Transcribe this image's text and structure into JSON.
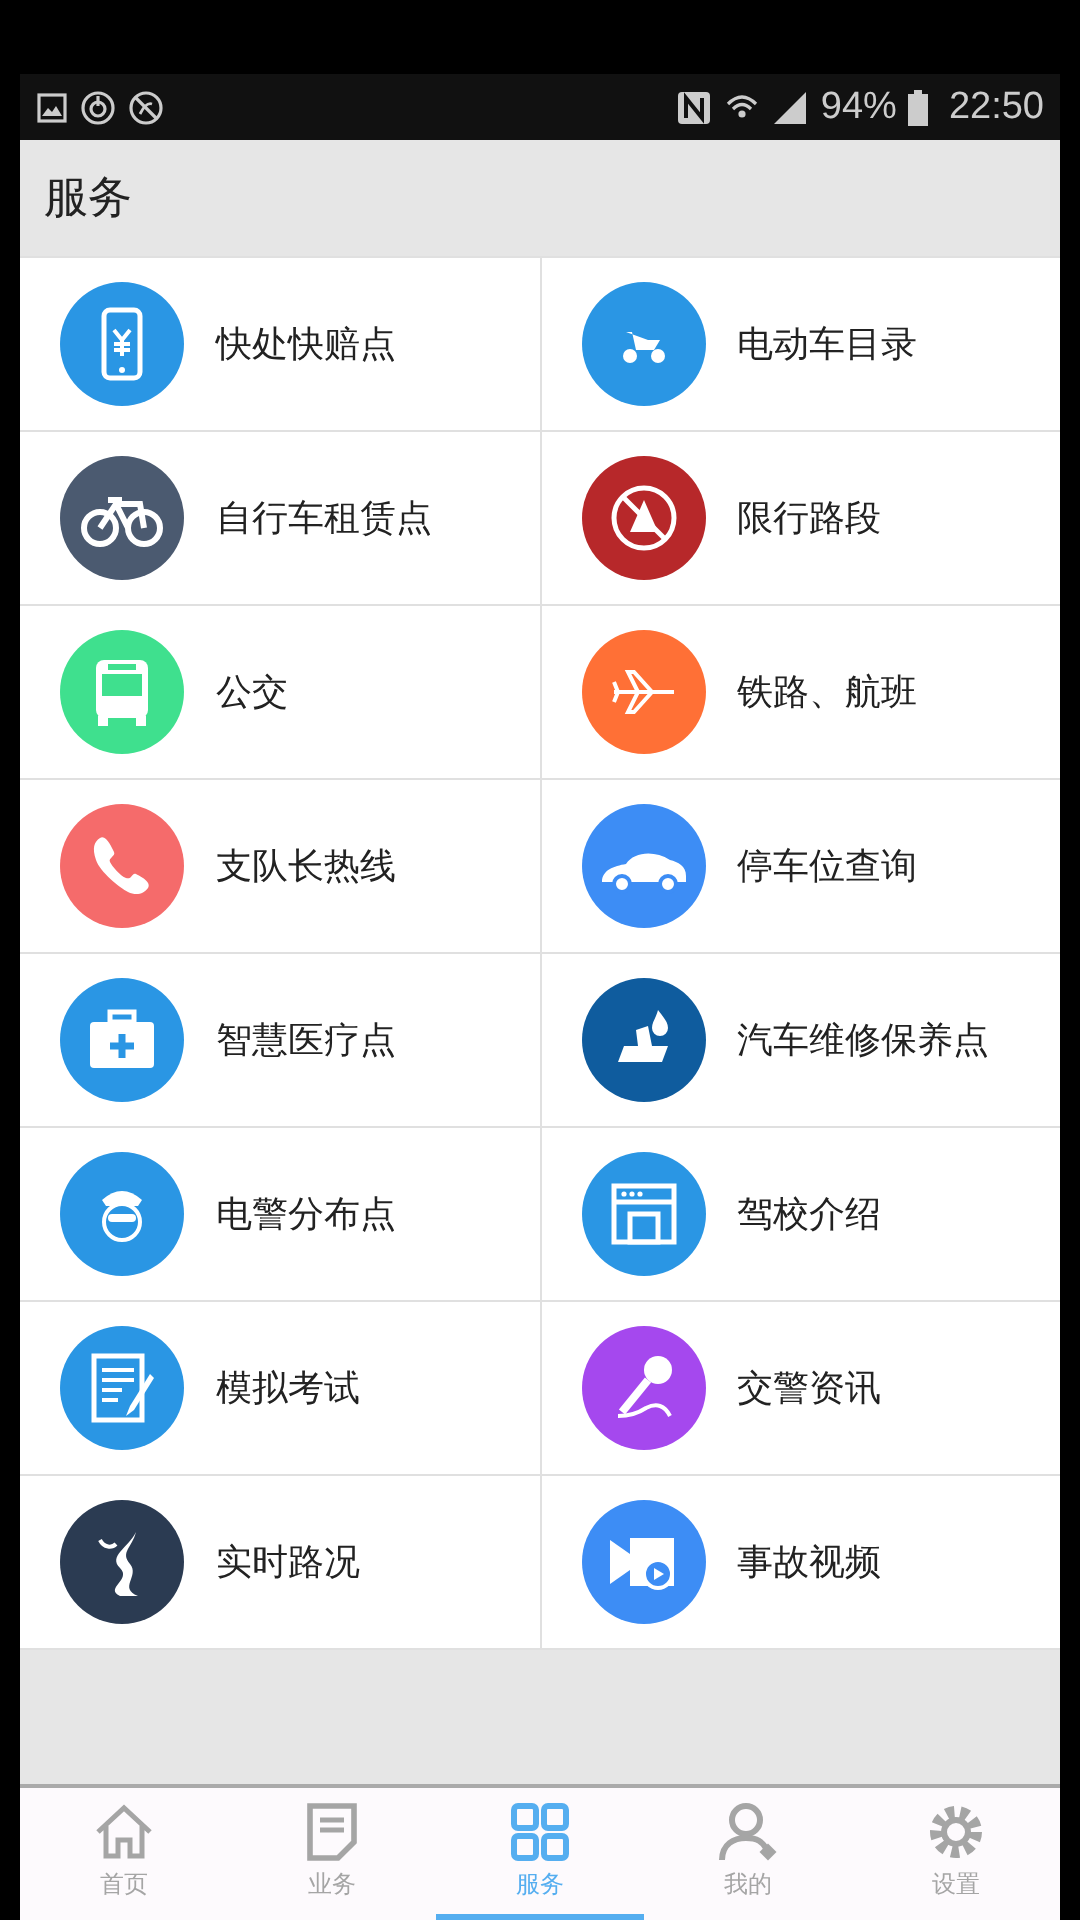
{
  "status_bar": {
    "battery": "94%",
    "time": "22:50"
  },
  "header": {
    "title": "服务"
  },
  "services": [
    {
      "label": "快处快赔点",
      "color": "#2a96e4"
    },
    {
      "label": "电动车目录",
      "color": "#2a96e4"
    },
    {
      "label": "自行车租赁点",
      "color": "#4b5a70"
    },
    {
      "label": "限行路段",
      "color": "#b7282a"
    },
    {
      "label": "公交",
      "color": "#3fe08e"
    },
    {
      "label": "铁路、航班",
      "color": "#ff7036"
    },
    {
      "label": "支队长热线",
      "color": "#f56b6b"
    },
    {
      "label": "停车位查询",
      "color": "#3d8df5"
    },
    {
      "label": "智慧医疗点",
      "color": "#2a96e4"
    },
    {
      "label": "汽车维修保养点",
      "color": "#0f5c9e"
    },
    {
      "label": "电警分布点",
      "color": "#2a96e4"
    },
    {
      "label": "驾校介绍",
      "color": "#2a96e4"
    },
    {
      "label": "模拟考试",
      "color": "#2a96e4"
    },
    {
      "label": "交警资讯",
      "color": "#a548ee"
    },
    {
      "label": "实时路况",
      "color": "#2b3b52"
    },
    {
      "label": "事故视频",
      "color": "#3d8df5"
    }
  ],
  "tabs": [
    {
      "label": "首页",
      "selected": false
    },
    {
      "label": "业务",
      "selected": false
    },
    {
      "label": "服务",
      "selected": true
    },
    {
      "label": "我的",
      "selected": false
    },
    {
      "label": "设置",
      "selected": false
    }
  ]
}
